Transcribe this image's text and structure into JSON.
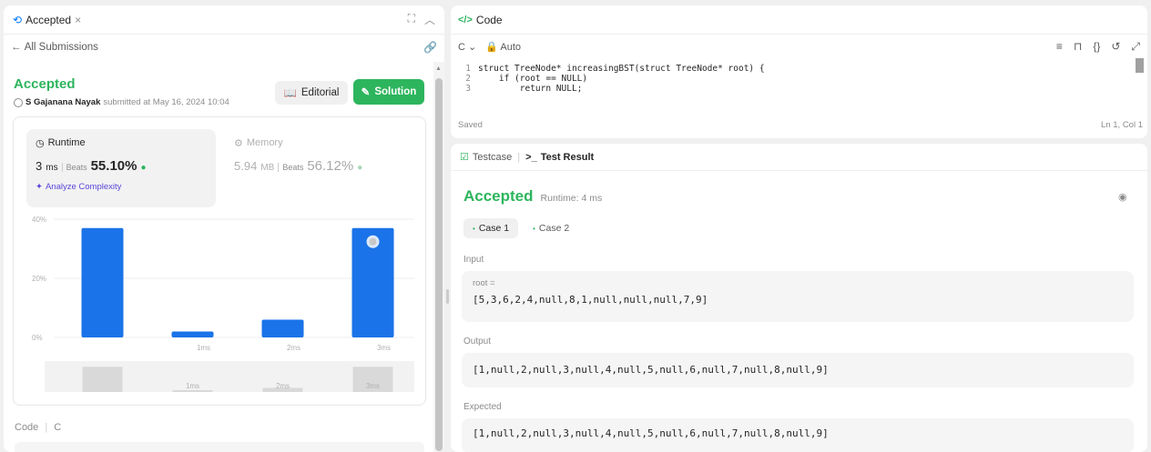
{
  "left": {
    "tab_label": "Accepted",
    "back_label": "All Submissions",
    "status": "Accepted",
    "author": "S Gajanana Nayak",
    "submitted_text": "submitted at May 16, 2024 10:04",
    "editorial_label": "Editorial",
    "solution_label": "Solution",
    "runtime": {
      "label": "Runtime",
      "value": "3",
      "unit": "ms",
      "beats_label": "Beats",
      "beats_pct": "55.10%",
      "analyze_label": "Analyze Complexity"
    },
    "memory": {
      "label": "Memory",
      "value": "5.94",
      "unit": "MB",
      "beats_label": "Beats",
      "beats_pct": "56.12%"
    },
    "code_footer_label": "Code",
    "code_footer_lang": "C"
  },
  "chart_data": {
    "type": "bar",
    "categories": [
      "",
      "1ms",
      "2ms",
      "3ms"
    ],
    "values": [
      37,
      2,
      6,
      37
    ],
    "ylim": [
      0,
      40
    ],
    "yticks": [
      "40%",
      "20%",
      "0%"
    ],
    "yticks_values": [
      40,
      20,
      0
    ],
    "highlight_index": 3,
    "bar_color": "#1a73e8",
    "overview_labels": [
      "1ms",
      "2ms",
      "3ms"
    ],
    "grid": true
  },
  "code_panel": {
    "title": "Code",
    "language": "C",
    "mode": "Auto",
    "lines": [
      {
        "no": "1",
        "text": "struct TreeNode* increasingBST(struct TreeNode* root) {"
      },
      {
        "no": "2",
        "text": "    if (root == NULL)"
      },
      {
        "no": "3",
        "text": "        return NULL;"
      }
    ],
    "saved_label": "Saved",
    "cursor_pos": "Ln 1, Col 1"
  },
  "result_panel": {
    "testcase_label": "Testcase",
    "test_result_label": "Test Result",
    "status": "Accepted",
    "runtime_text": "Runtime: 4 ms",
    "cases": [
      "Case 1",
      "Case 2"
    ],
    "input_label": "Input",
    "input_var": "root =",
    "input_value": "[5,3,6,2,4,null,8,1,null,null,null,7,9]",
    "output_label": "Output",
    "output_value": "[1,null,2,null,3,null,4,null,5,null,6,null,7,null,8,null,9]",
    "expected_label": "Expected",
    "expected_value": "[1,null,2,null,3,null,4,null,5,null,6,null,7,null,8,null,9]"
  },
  "colors": {
    "accepted_green": "#2db55d",
    "bar_blue": "#1a73e8",
    "analyze_purple": "#5a47d9"
  }
}
